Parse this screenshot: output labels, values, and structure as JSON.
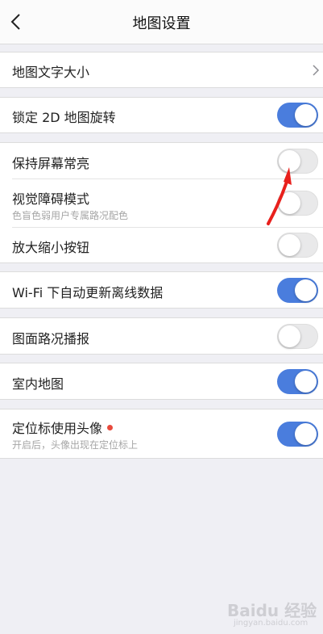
{
  "header": {
    "title": "地图设置",
    "back_icon": "chevron-left-icon"
  },
  "settings": {
    "text_size": {
      "label": "地图文字大小"
    },
    "lock_2d_rotation": {
      "label": "锁定 2D 地图旋转",
      "enabled": true
    },
    "keep_screen_on": {
      "label": "保持屏幕常亮",
      "enabled": false
    },
    "vision_mode": {
      "label": "视觉障碍模式",
      "subtitle": "色盲色弱用户专属路况配色",
      "enabled": false
    },
    "zoom_buttons": {
      "label": "放大缩小按钮",
      "enabled": false
    },
    "wifi_offline_update": {
      "label": "Wi-Fi 下自动更新离线数据",
      "enabled": true
    },
    "traffic_broadcast": {
      "label": "图面路况播报",
      "enabled": false
    },
    "indoor_map": {
      "label": "室内地图",
      "enabled": true
    },
    "avatar_locator": {
      "label": "定位标使用头像",
      "subtitle": "开启后，头像出现在定位标上",
      "enabled": true,
      "new_badge": true
    }
  },
  "watermark": {
    "brand": "Baidu 经验",
    "url": "jingyan.baidu.com"
  },
  "colors": {
    "toggle_on": "#4a7ddd",
    "toggle_off": "#e9e9ea",
    "badge_red": "#e84a3d",
    "annotation_arrow": "#e8201c",
    "background": "#efeff4"
  }
}
